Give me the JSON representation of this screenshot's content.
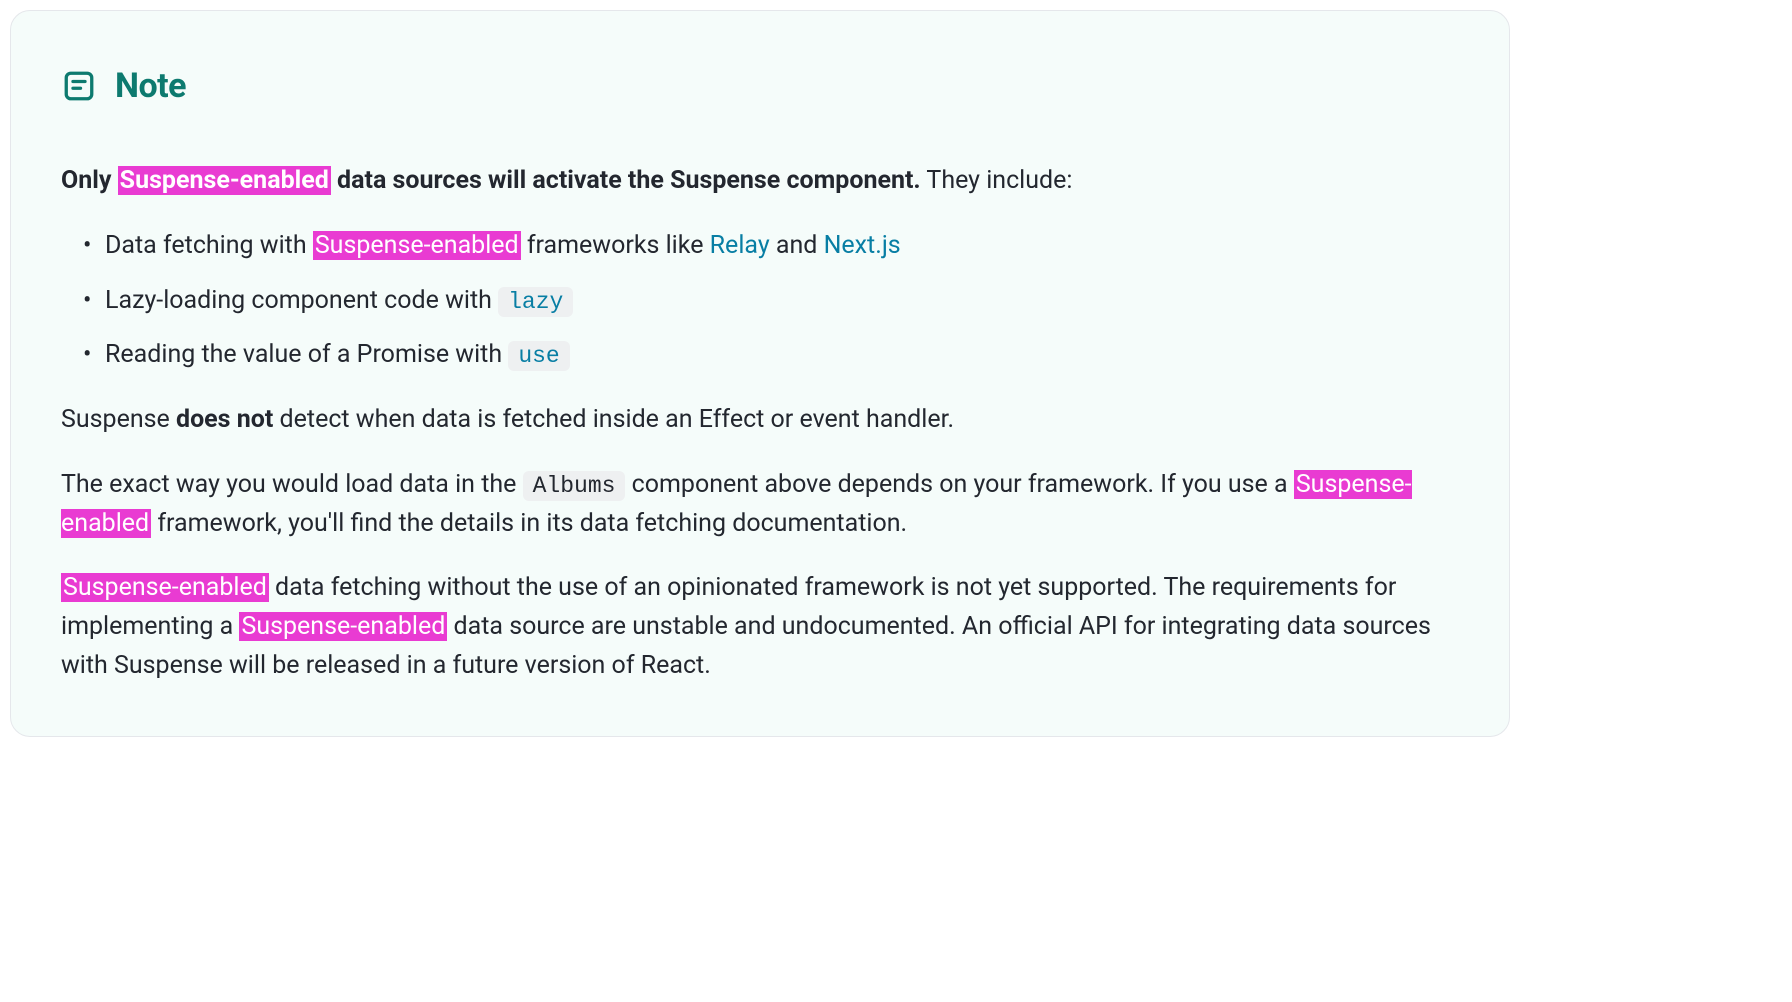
{
  "note": {
    "title": "Note",
    "highlight_term": "Suspense-enabled",
    "intro": {
      "bold_prefix": "Only ",
      "bold_suffix": " data sources will activate the Suspense component.",
      "rest": " They include:"
    },
    "bullets": [
      {
        "prefix": "Data fetching with ",
        "after_highlight": " frameworks like ",
        "link1_text": "Relay",
        "between_links": " and ",
        "link2_text": "Next.js"
      },
      {
        "text": "Lazy-loading component code with ",
        "code": "lazy"
      },
      {
        "text": "Reading the value of a Promise with ",
        "code": "use"
      }
    ],
    "para2": {
      "prefix": "Suspense ",
      "bold": "does not",
      "suffix": " detect when data is fetched inside an Effect or event handler."
    },
    "para3": {
      "part1": "The exact way you would load data in the ",
      "code": "Albums",
      "part2": " component above depends on your framework. If you use a ",
      "part3": " framework, you'll find the details in its data fetching documentation."
    },
    "para4": {
      "part1": " data fetching without the use of an opinionated framework is not yet supported. The requirements for implementing a ",
      "part2": " data source are unstable and undocumented. An official API for integrating data sources with Suspense will be released in a future version of React."
    }
  }
}
